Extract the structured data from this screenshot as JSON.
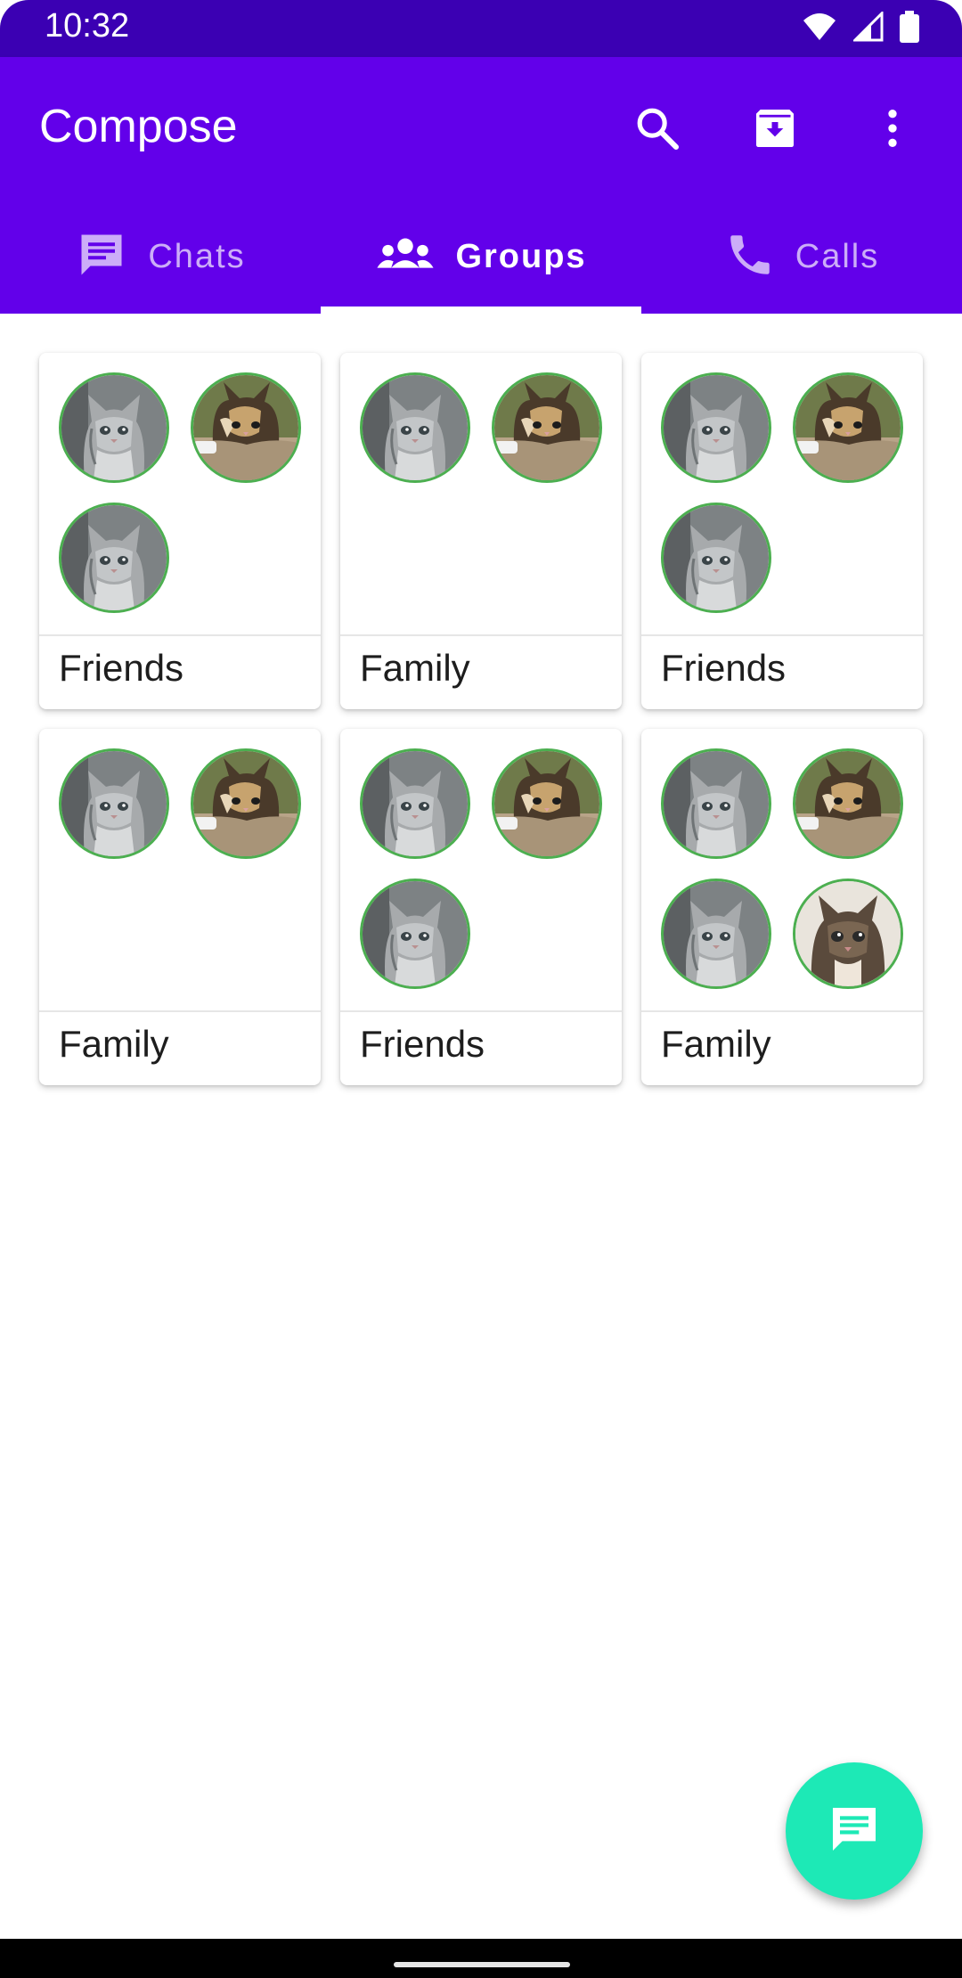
{
  "status_bar": {
    "time": "10:32"
  },
  "app_bar": {
    "title": "Compose",
    "icons": [
      "search-icon",
      "archive-icon",
      "more-vert-icon"
    ]
  },
  "tabs": [
    {
      "label": "Chats",
      "icon": "chat-icon",
      "selected": false
    },
    {
      "label": "Groups",
      "icon": "groups-icon",
      "selected": true
    },
    {
      "label": "Calls",
      "icon": "phone-icon",
      "selected": false
    }
  ],
  "groups": [
    {
      "name": "Friends",
      "avatars": [
        "grey-kitten",
        "calico-kitten",
        "grey-kitten"
      ]
    },
    {
      "name": "Family",
      "avatars": [
        "grey-kitten",
        "calico-kitten"
      ]
    },
    {
      "name": "Friends",
      "avatars": [
        "grey-kitten",
        "calico-kitten",
        "grey-kitten"
      ]
    },
    {
      "name": "Family",
      "avatars": [
        "grey-kitten",
        "calico-kitten"
      ]
    },
    {
      "name": "Friends",
      "avatars": [
        "grey-kitten",
        "calico-kitten",
        "grey-kitten"
      ]
    },
    {
      "name": "Family",
      "avatars": [
        "grey-kitten",
        "calico-kitten",
        "grey-kitten",
        "tabby-kitten"
      ]
    }
  ],
  "fab": {
    "icon": "message-icon"
  },
  "colors": {
    "primary": "#6200ea",
    "status_bar": "#3b00b3",
    "fab": "#1de9b6",
    "avatar_border": "#4caf50"
  }
}
